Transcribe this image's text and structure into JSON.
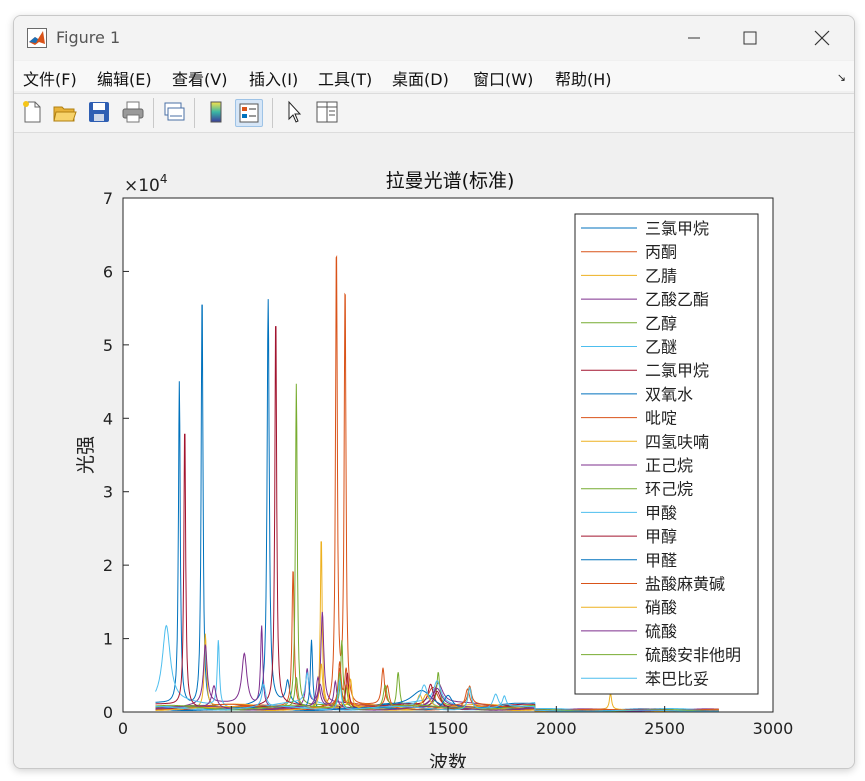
{
  "window": {
    "title": "Figure 1"
  },
  "menu": [
    "文件(F)",
    "编辑(E)",
    "查看(V)",
    "插入(I)",
    "工具(T)",
    "桌面(D)",
    "窗口(W)",
    "帮助(H)"
  ],
  "toolbar": [
    "new-figure-icon",
    "open-file-icon",
    "save-icon",
    "print-icon",
    "link-plot-icon",
    "colorbar-icon",
    "legend-icon",
    "edit-plot-icon",
    "property-inspector-icon"
  ],
  "chart_data": {
    "type": "line",
    "title": "拉曼光谱(标准)",
    "xlabel": "波数",
    "ylabel": "光强",
    "xlim": [
      0,
      3000
    ],
    "ylim": [
      0,
      70000
    ],
    "xticks": [
      "0",
      "500",
      "1000",
      "1500",
      "2000",
      "2500",
      "3000"
    ],
    "yticks": [
      "0",
      "1",
      "2",
      "3",
      "4",
      "5",
      "6",
      "7"
    ],
    "y_exponent": "×10^4",
    "grid": false,
    "legend_position": "top-right",
    "x_range_data": [
      150,
      2750
    ],
    "series": [
      {
        "name": "三氯甲烷",
        "color": "#0072BD",
        "baseline": 800,
        "peaks": [
          [
            260,
            44000,
            5
          ],
          [
            365,
            57000,
            5
          ],
          [
            670,
            55000,
            6
          ],
          [
            760,
            3000,
            10
          ]
        ]
      },
      {
        "name": "丙酮",
        "color": "#D95319",
        "baseline": 600,
        "peaks": [
          [
            985,
            63000,
            5
          ],
          [
            1025,
            57500,
            5
          ],
          [
            785,
            19000,
            6
          ],
          [
            1200,
            5000,
            8
          ],
          [
            1430,
            3000,
            30
          ]
        ]
      },
      {
        "name": "乙腈",
        "color": "#EDB120",
        "baseline": 700,
        "peaks": [
          [
            915,
            23500,
            5
          ],
          [
            380,
            10000,
            6
          ],
          [
            2250,
            2200,
            6
          ],
          [
            1370,
            2000,
            15
          ]
        ]
      },
      {
        "name": "乙酸乙酯",
        "color": "#7E2F8E",
        "baseline": 800,
        "peaks": [
          [
            380,
            8000,
            10
          ],
          [
            560,
            7000,
            14
          ],
          [
            640,
            11000,
            6
          ],
          [
            850,
            5000,
            8
          ],
          [
            920,
            12500,
            8
          ],
          [
            1455,
            3000,
            25
          ]
        ]
      },
      {
        "name": "乙醇",
        "color": "#77AC30",
        "baseline": 600,
        "peaks": [
          [
            800,
            44000,
            5
          ],
          [
            1010,
            9000,
            6
          ],
          [
            1270,
            5000,
            8
          ],
          [
            1455,
            4500,
            8
          ]
        ]
      },
      {
        "name": "乙醚",
        "color": "#4DBEEE",
        "baseline": 900,
        "peaks": [
          [
            200,
            10500,
            22
          ],
          [
            440,
            9000,
            6
          ],
          [
            850,
            4000,
            10
          ],
          [
            1450,
            3000,
            20
          ]
        ]
      },
      {
        "name": "二氯甲烷",
        "color": "#A2142F",
        "baseline": 700,
        "peaks": [
          [
            285,
            38500,
            5
          ],
          [
            705,
            53500,
            5
          ],
          [
            1420,
            3000,
            15
          ]
        ]
      },
      {
        "name": "双氧水",
        "color": "#0072BD",
        "baseline": 500,
        "peaks": [
          [
            870,
            9500,
            6
          ],
          [
            1380,
            2500,
            60
          ]
        ]
      },
      {
        "name": "吡啶",
        "color": "#D95319",
        "baseline": 500,
        "peaks": [
          [
            1000,
            6000,
            8
          ],
          [
            1030,
            5000,
            8
          ],
          [
            1590,
            2500,
            12
          ]
        ]
      },
      {
        "name": "四氢呋喃",
        "color": "#EDB120",
        "baseline": 500,
        "peaks": [
          [
            915,
            6000,
            8
          ],
          [
            1030,
            3000,
            8
          ]
        ]
      },
      {
        "name": "正己烷",
        "color": "#7E2F8E",
        "baseline": 500,
        "peaks": [
          [
            900,
            4000,
            10
          ],
          [
            1450,
            2500,
            25
          ]
        ]
      },
      {
        "name": "环己烷",
        "color": "#77AC30",
        "baseline": 500,
        "peaks": [
          [
            800,
            4000,
            8
          ],
          [
            1030,
            3000,
            8
          ]
        ]
      },
      {
        "name": "甲酸",
        "color": "#4DBEEE",
        "baseline": 500,
        "peaks": [
          [
            1390,
            3000,
            20
          ],
          [
            1720,
            2000,
            15
          ]
        ]
      },
      {
        "name": "甲醇",
        "color": "#A2142F",
        "baseline": 500,
        "peaks": [
          [
            1035,
            5000,
            8
          ],
          [
            1450,
            2500,
            20
          ]
        ]
      },
      {
        "name": "甲醛",
        "color": "#0072BD",
        "baseline": 400,
        "peaks": [
          [
            1500,
            2000,
            25
          ]
        ]
      },
      {
        "name": "盐酸麻黄碱",
        "color": "#D95319",
        "baseline": 700,
        "peaks": [
          [
            1000,
            5000,
            8
          ],
          [
            1220,
            3000,
            10
          ],
          [
            1600,
            2500,
            10
          ]
        ]
      },
      {
        "name": "硝酸",
        "color": "#EDB120",
        "baseline": 400,
        "peaks": [
          [
            1050,
            4000,
            8
          ],
          [
            1400,
            2000,
            20
          ]
        ]
      },
      {
        "name": "硫酸",
        "color": "#7E2F8E",
        "baseline": 500,
        "peaks": [
          [
            420,
            3000,
            12
          ],
          [
            910,
            3000,
            12
          ],
          [
            980,
            3500,
            8
          ]
        ]
      },
      {
        "name": "硫酸安非他明",
        "color": "#77AC30",
        "baseline": 600,
        "peaks": [
          [
            1000,
            5000,
            8
          ],
          [
            1210,
            3000,
            10
          ],
          [
            1600,
            3000,
            10
          ]
        ]
      },
      {
        "name": "苯巴比妥",
        "color": "#4DBEEE",
        "baseline": 500,
        "peaks": [
          [
            650,
            3000,
            10
          ],
          [
            1000,
            4000,
            8
          ],
          [
            1600,
            3000,
            10
          ],
          [
            1760,
            1500,
            10
          ]
        ]
      }
    ]
  }
}
